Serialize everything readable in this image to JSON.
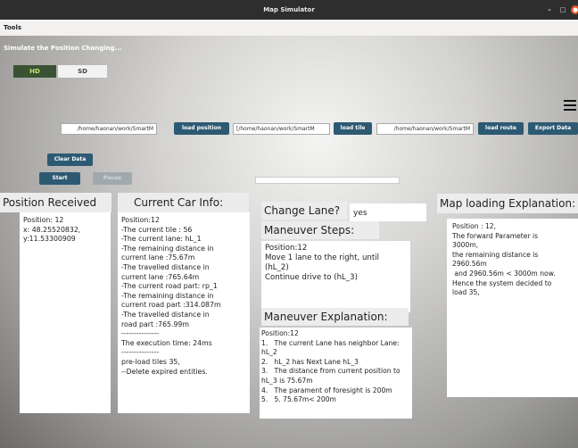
{
  "window": {
    "title": "Map Simulator",
    "minimize": "–",
    "maximize": "□",
    "close": "●"
  },
  "menu": {
    "tools": "Tools"
  },
  "sim": {
    "heading": "Simulate the Position Changing..."
  },
  "tabs": {
    "hd": "HD",
    "sd": "SD"
  },
  "paths": {
    "position": "/home/haonan/work/SmartM",
    "tile": "[/home/haonan/work/SmartM",
    "route": "/home/haonan/work/SmartM"
  },
  "buttons": {
    "load_position": "load position",
    "load_tile": "load tile",
    "load_route": "load route",
    "export_data": "Export Data",
    "clear_data": "Clear Data",
    "start": "Start",
    "pause": "Pause"
  },
  "position_received": {
    "title": "Position Received",
    "lines": [
      "Position: 12",
      "x: 48.25520832,",
      "y:11.53300909"
    ]
  },
  "car_info": {
    "title": "Current Car Info:",
    "lines": [
      "Position:12",
      "-The current tile : 56",
      "-The current lane: hL_1",
      "-The remaining distance in",
      "current lane :75.67m",
      "-The travelled distance in",
      "current lane :765.64m",
      "-The current road part: rp_1",
      "-The remaining distance in",
      "current road part :314.087m",
      "-The travelled distance in",
      "road part :765.99m",
      "---------------",
      "The execution time: 24ms",
      "---------------",
      "pre-load tiles 35,",
      "--Delete expired entities."
    ]
  },
  "change_lane": {
    "label": "Change Lane?",
    "value": "yes"
  },
  "maneuver_steps": {
    "title": "Maneuver Steps:",
    "lines": [
      "Position:12",
      "Move 1 lane to the right, until  (hL_2)",
      "Continue drive to (hL_3)"
    ]
  },
  "maneuver_explanation": {
    "title": "Maneuver Explanation:",
    "lines": [
      "Position:12",
      "1.   The current Lane has neighbor Lane:",
      "hL_2",
      "2.   hL_2 has Next Lane hL_3",
      "3.   The distance from current position to",
      "hL_3 is 75.67m",
      "4.   The parament of foresight is 200m",
      "5.   5. 75.67m< 200m"
    ]
  },
  "map_loading": {
    "title": "Map loading Explanation:",
    "lines": [
      "Position : 12,",
      "The forward Parameter is",
      "3000m,",
      "the remaining distance is",
      "2960.56m",
      " and 2960.56m < 3000m now.",
      "Hence the system decided to",
      "load 35,"
    ]
  }
}
